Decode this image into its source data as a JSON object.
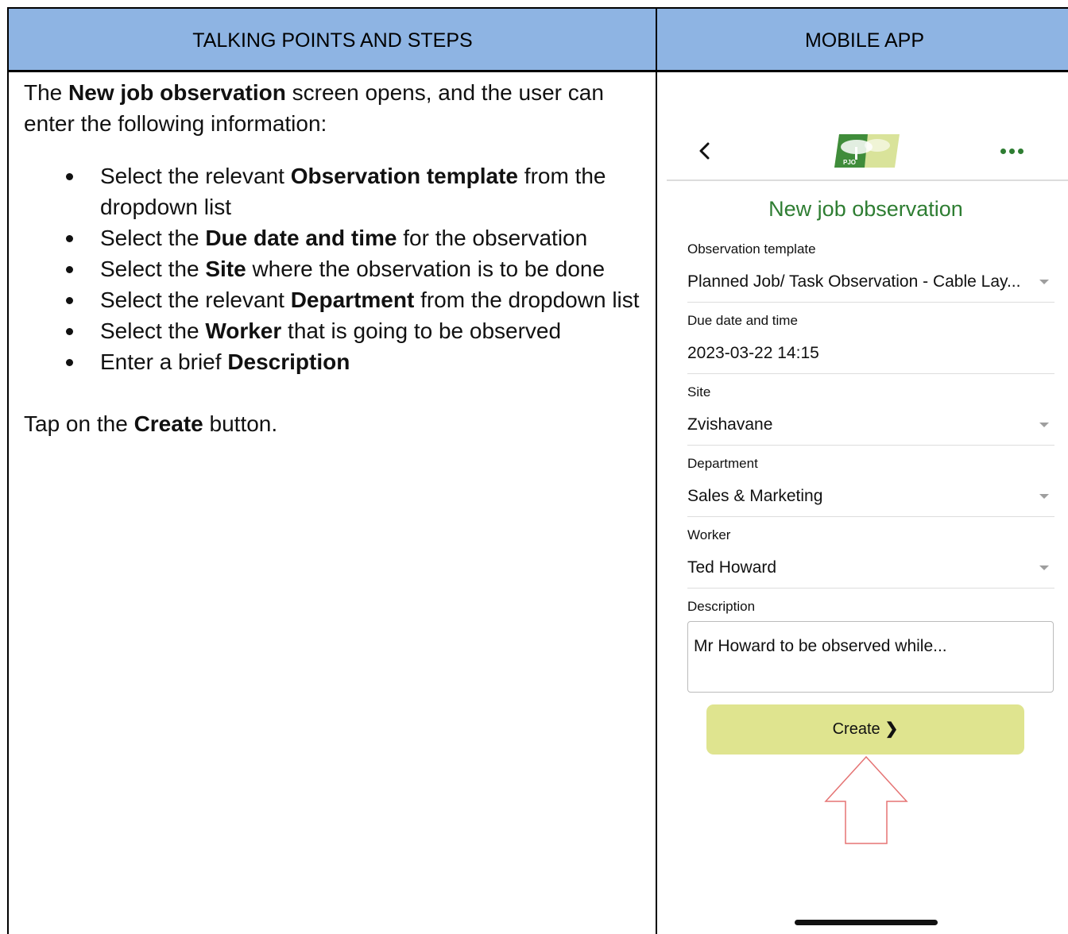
{
  "table": {
    "header_left": "TALKING POINTS AND STEPS",
    "header_right": "MOBILE APP"
  },
  "left": {
    "intro_pre": "The ",
    "intro_bold": "New job observation",
    "intro_post": " screen opens, and the user can enter the following information:",
    "steps": [
      {
        "pre": "Select the relevant ",
        "bold": "Observation template",
        "post": " from the dropdown list"
      },
      {
        "pre": "Select the ",
        "bold": "Due date and time",
        "post": " for the observation"
      },
      {
        "pre": "Select the ",
        "bold": "Site",
        "post": " where the observation is to be done"
      },
      {
        "pre": "Select the relevant ",
        "bold": "Department",
        "post": " from the dropdown list"
      },
      {
        "pre": "Select the ",
        "bold": "Worker",
        "post": " that is going to be observed"
      },
      {
        "pre": "Enter a brief ",
        "bold": "Description",
        "post": ""
      }
    ],
    "tap_pre": "Tap on the ",
    "tap_bold": "Create",
    "tap_post": " button."
  },
  "app": {
    "back_glyph": "‹",
    "logo_text": "PJO",
    "title": "New job observation",
    "fields": {
      "template_label": "Observation template",
      "template_value": "Planned Job/ Task Observation - Cable Lay...",
      "due_label": "Due date and time",
      "due_value": "2023-03-22 14:15",
      "site_label": "Site",
      "site_value": "Zvishavane",
      "department_label": "Department",
      "department_value": "Sales & Marketing",
      "worker_label": "Worker",
      "worker_value": "Ted Howard",
      "description_label": "Description",
      "description_value": "Mr Howard to be observed while..."
    },
    "create_label": "Create",
    "create_chevron": "❯",
    "colors": {
      "accent_green": "#2e7d32",
      "button_fill": "#dfe48f",
      "header_blue": "#8eb4e3",
      "arrow_red": "#e57373"
    }
  }
}
